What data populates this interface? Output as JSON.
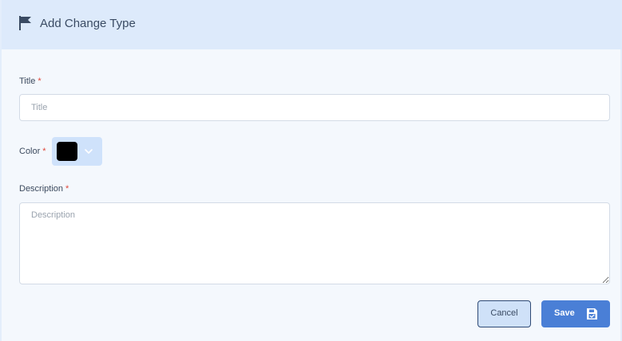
{
  "header": {
    "title": "Add Change Type",
    "icon": "flag-icon"
  },
  "form": {
    "title_label": "Title",
    "title_placeholder": "Title",
    "title_value": "",
    "color_label": "Color",
    "color_value": "#000000",
    "description_label": "Description",
    "description_placeholder": "Description",
    "description_value": "",
    "required_mark": "*"
  },
  "actions": {
    "cancel_label": "Cancel",
    "save_label": "Save",
    "save_icon": "floppy-disk-icon"
  },
  "colors": {
    "header_bg": "#ddeafb",
    "accent": "#4a7fd6",
    "required": "#e0473a"
  }
}
